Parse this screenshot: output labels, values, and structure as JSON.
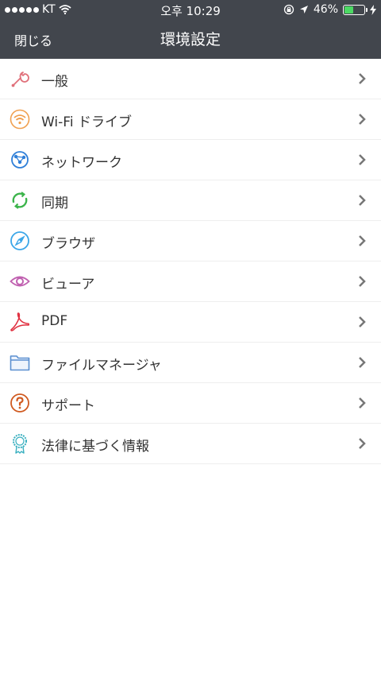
{
  "status_bar": {
    "carrier": "KT",
    "time": "오후 10:29",
    "battery_percent": "46%",
    "battery_level": 0.46
  },
  "nav": {
    "close_label": "閉じる",
    "title": "環境設定"
  },
  "items": [
    {
      "label": "一般",
      "icon": "wrench-icon",
      "color": "#e0707a"
    },
    {
      "label": "Wi-Fi ドライブ",
      "icon": "wifi-icon",
      "color": "#f0a050"
    },
    {
      "label": "ネットワーク",
      "icon": "network-icon",
      "color": "#2f7fd8"
    },
    {
      "label": "同期",
      "icon": "sync-icon",
      "color": "#3cb44b"
    },
    {
      "label": "ブラウザ",
      "icon": "compass-icon",
      "color": "#3aa6e8"
    },
    {
      "label": "ビューア",
      "icon": "eye-icon",
      "color": "#c060b0"
    },
    {
      "label": "PDF",
      "icon": "pdf-icon",
      "color": "#e03040"
    },
    {
      "label": "ファイルマネージャ",
      "icon": "folder-icon",
      "color": "#5a8fd0"
    },
    {
      "label": "サポート",
      "icon": "help-icon",
      "color": "#d05a20"
    },
    {
      "label": "法律に基づく情報",
      "icon": "badge-icon",
      "color": "#3ab0c0"
    }
  ]
}
